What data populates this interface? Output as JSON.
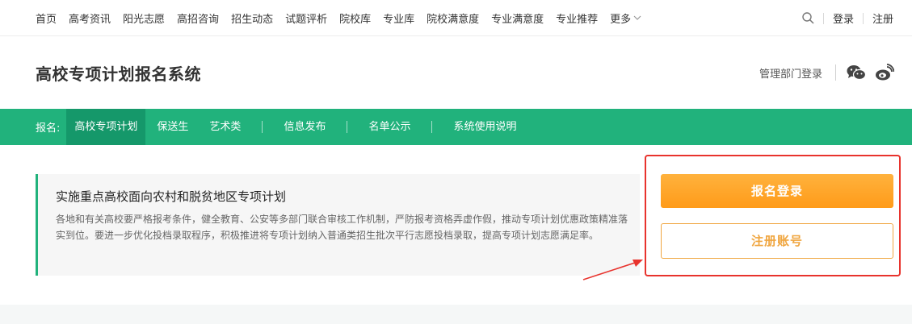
{
  "topnav": {
    "links": [
      "首页",
      "高考资讯",
      "阳光志愿",
      "高招咨询",
      "招生动态",
      "试题评析",
      "院校库",
      "专业库",
      "院校满意度",
      "专业满意度",
      "专业推荐"
    ],
    "more": "更多",
    "login": "登录",
    "register": "注册"
  },
  "header": {
    "title": "高校专项计划报名系统",
    "admin_login": "管理部门登录"
  },
  "greenbar": {
    "label": "报名:",
    "items": [
      "高校专项计划",
      "保送生",
      "艺术类",
      "信息发布",
      "名单公示",
      "系统使用说明"
    ]
  },
  "info": {
    "heading": "实施重点高校面向农村和脱贫地区专项计划",
    "text": "各地和有关高校要严格报考条件，健全教育、公安等多部门联合审核工作机制，严防报考资格弄虚作假，推动专项计划优惠政策精准落实到位。要进一步优化投档录取程序，积极推进将专项计划纳入普通类招生批次平行志愿投档录取，提高专项计划志愿满足率。"
  },
  "actions": {
    "login_button": "报名登录",
    "register_button": "注册账号"
  },
  "colors": {
    "brand_green": "#21b27c",
    "active_green": "#15986a",
    "orange": "#ff9b19",
    "highlight_red": "#e8332d"
  }
}
